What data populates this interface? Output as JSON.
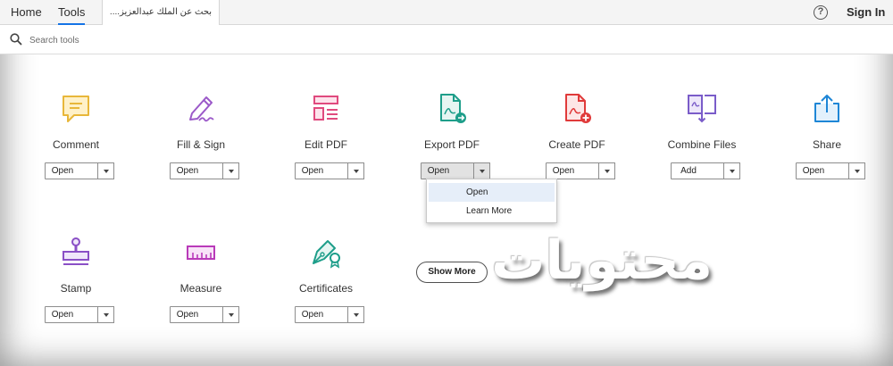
{
  "nav": {
    "home": "Home",
    "tools": "Tools",
    "document_tab": "بحث عن الملك عبدالعزيز....",
    "help": "?",
    "sign_in": "Sign In"
  },
  "search": {
    "placeholder": "Search tools"
  },
  "tools": [
    {
      "label": "Comment",
      "button": "Open",
      "icon": "comment-icon",
      "color": "#e8b73a"
    },
    {
      "label": "Fill & Sign",
      "button": "Open",
      "icon": "fill-sign-icon",
      "color": "#9b59c9"
    },
    {
      "label": "Edit PDF",
      "button": "Open",
      "icon": "edit-pdf-icon",
      "color": "#e04a7e"
    },
    {
      "label": "Export PDF",
      "button": "Open",
      "icon": "export-pdf-icon",
      "color": "#1e9e8a"
    },
    {
      "label": "Create PDF",
      "button": "Open",
      "icon": "create-pdf-icon",
      "color": "#e03a3a"
    },
    {
      "label": "Combine Files",
      "button": "Add",
      "icon": "combine-files-icon",
      "color": "#7a5cc9"
    },
    {
      "label": "Share",
      "button": "Open",
      "icon": "share-icon",
      "color": "#1e86d6"
    },
    {
      "label": "Stamp",
      "button": "Open",
      "icon": "stamp-icon",
      "color": "#8a4fc6"
    },
    {
      "label": "Measure",
      "button": "Open",
      "icon": "measure-icon",
      "color": "#b93ab9"
    },
    {
      "label": "Certificates",
      "button": "Open",
      "icon": "certificates-icon",
      "color": "#1e9e8a"
    }
  ],
  "dropdown_menu": {
    "items": [
      "Open",
      "Learn More"
    ]
  },
  "show_more": "Show More",
  "watermark": "محتويات",
  "colors": {
    "accent": "#1473e6",
    "menu_highlight": "#e6eef9"
  }
}
